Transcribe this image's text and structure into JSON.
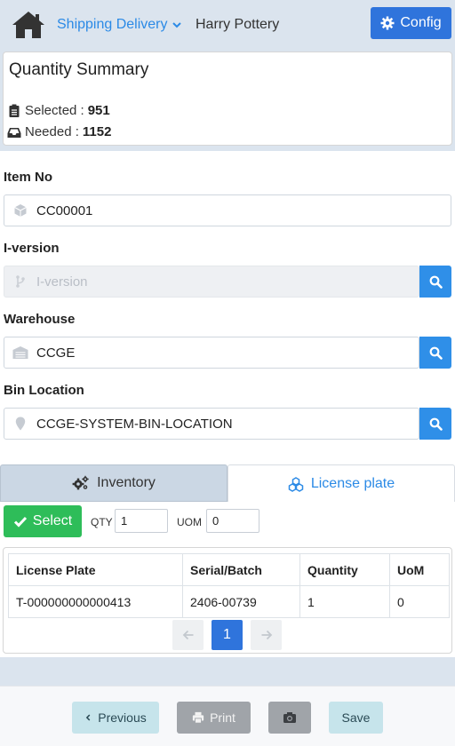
{
  "header": {
    "nav_label": "Shipping Delivery",
    "user_name": "Harry Pottery",
    "config_label": "Config"
  },
  "summary": {
    "title": "Quantity Summary",
    "selected_label": "Selected :",
    "selected_value": "951",
    "needed_label": "Needed :",
    "needed_value": "1152"
  },
  "form": {
    "item_no": {
      "label": "Item No",
      "value": "CC00001"
    },
    "i_version": {
      "label": "I-version",
      "placeholder": "I-version"
    },
    "warehouse": {
      "label": "Warehouse",
      "value": "CCGE"
    },
    "bin_location": {
      "label": "Bin Location",
      "value": "CCGE-SYSTEM-BIN-LOCATION"
    }
  },
  "tabs": [
    {
      "label": "Inventory",
      "active": false
    },
    {
      "label": "License plate",
      "active": true
    }
  ],
  "controls": {
    "select_label": "Select",
    "qty_label": "QTY",
    "qty_value": "1",
    "uom_label": "UOM",
    "uom_value": "0"
  },
  "table": {
    "headers": [
      "License Plate",
      "Serial/Batch",
      "Quantity",
      "UoM"
    ],
    "rows": [
      [
        "T-000000000000413",
        "2406-00739",
        "1",
        "0"
      ]
    ]
  },
  "pagination": {
    "current_page": "1"
  },
  "footer": {
    "previous_label": "Previous",
    "print_label": "Print",
    "save_label": "Save"
  },
  "colors": {
    "primary": "#2f74dc",
    "link": "#2b8ae6",
    "success": "#2ebd59",
    "search": "#2f8fe8",
    "background": "#dbe4ee"
  }
}
